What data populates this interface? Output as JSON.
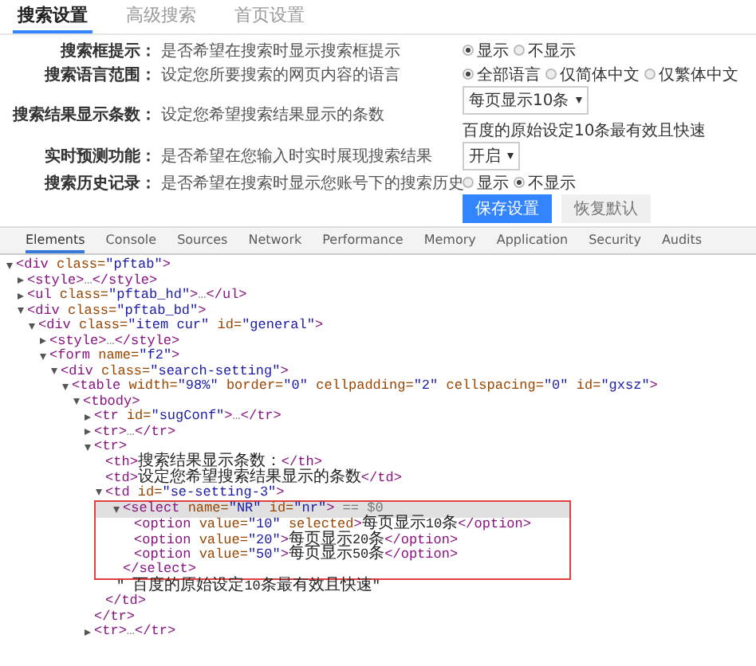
{
  "settings_tabs": [
    {
      "label": "搜索设置",
      "selected": true
    },
    {
      "label": "高级搜索",
      "selected": false
    },
    {
      "label": "首页设置",
      "selected": false
    }
  ],
  "settings_rows": [
    {
      "kind": "radio",
      "label": "搜索框提示：",
      "description": "是否希望在搜索时显示搜索框提示",
      "options": [
        {
          "label": "显示",
          "selected": true
        },
        {
          "label": "不显示",
          "selected": false
        }
      ]
    },
    {
      "kind": "radio",
      "label": "搜索语言范围：",
      "description": "设定您所要搜索的网页内容的语言",
      "options": [
        {
          "label": "全部语言",
          "selected": true
        },
        {
          "label": "仅简体中文",
          "selected": false
        },
        {
          "label": "仅繁体中文",
          "selected": false
        }
      ]
    },
    {
      "kind": "select",
      "label": "搜索结果显示条数：",
      "description": "设定您希望搜索结果显示的条数",
      "value": "每页显示10条",
      "note": "百度的原始设定10条最有效且快速"
    },
    {
      "kind": "select",
      "label": "实时预测功能：",
      "description": "是否希望在您输入时实时展现搜索结果",
      "value": "开启"
    },
    {
      "kind": "radio",
      "label": "搜索历史记录：",
      "description": "是否希望在搜索时显示您账号下的搜索历史",
      "options": [
        {
          "label": "显示",
          "selected": false
        },
        {
          "label": "不显示",
          "selected": true
        }
      ]
    }
  ],
  "buttons": [
    {
      "label": "保存设置",
      "kind": "primary"
    },
    {
      "label": "恢复默认",
      "kind": "secondary"
    }
  ],
  "devtools_tabs": [
    {
      "label": "Elements",
      "selected": true
    },
    {
      "label": "Console",
      "selected": false
    },
    {
      "label": "Sources",
      "selected": false
    },
    {
      "label": "Network",
      "selected": false
    },
    {
      "label": "Performance",
      "selected": false
    },
    {
      "label": "Memory",
      "selected": false
    },
    {
      "label": "Application",
      "selected": false
    },
    {
      "label": "Security",
      "selected": false
    },
    {
      "label": "Audits",
      "selected": false
    }
  ],
  "dom_tree": [
    {
      "text": "<div class=\"pftab\">",
      "expanded": true,
      "selected": false,
      "children": [
        {
          "text": "<style>…</style>",
          "expanded": false,
          "selected": false
        },
        {
          "text": "<ul class=\"pftab_hd\">…</ul>",
          "expanded": false,
          "selected": false
        },
        {
          "text": "<div class=\"pftab_bd\">",
          "expanded": true,
          "selected": false,
          "children": [
            {
              "text": "<div class=\"item cur\" id=\"general\">",
              "expanded": true,
              "selected": false,
              "children": [
                {
                  "text": "<style>…</style>",
                  "expanded": false,
                  "selected": false
                },
                {
                  "text": "<form name=\"f2\">",
                  "expanded": true,
                  "selected": false,
                  "children": [
                    {
                      "text": "<div class=\"search-setting\">",
                      "expanded": true,
                      "selected": false,
                      "children": [
                        {
                          "text": "<table width=\"98%\" border=\"0\" cellpadding=\"2\" cellspacing=\"0\" id=\"gxsz\">",
                          "expanded": true,
                          "selected": false,
                          "children": [
                            {
                              "text": "<tbody>",
                              "expanded": true,
                              "selected": false,
                              "children": [
                                {
                                  "text": "<tr id=\"sugConf\">…</tr>",
                                  "expanded": false,
                                  "selected": false
                                },
                                {
                                  "text": "<tr>…</tr>",
                                  "expanded": false,
                                  "selected": false
                                },
                                {
                                  "text": "<tr>",
                                  "expanded": true,
                                  "selected": false,
                                  "close": "</tr>",
                                  "children": [
                                    {
                                      "text": "<th>搜索结果显示条数：</th>",
                                      "selected": false
                                    },
                                    {
                                      "text": "<td>设定您希望搜索结果显示的条数</td>",
                                      "selected": false
                                    },
                                    {
                                      "text": "<td id=\"se-setting-3\">",
                                      "expanded": true,
                                      "selected": false,
                                      "close": "</td>",
                                      "children": [
                                        {
                                          "text": "<select name=\"NR\" id=\"nr\">",
                                          "suffix": " == $0",
                                          "expanded": true,
                                          "selected": true,
                                          "close": "</select>",
                                          "children": [
                                            {
                                              "text": "<option value=\"10\" selected>每页显示10条</option>",
                                              "selected": false
                                            },
                                            {
                                              "text": "<option value=\"20\">每页显示20条</option>",
                                              "selected": false
                                            },
                                            {
                                              "text": "<option value=\"50\">每页显示50条</option>",
                                              "selected": false
                                            }
                                          ]
                                        },
                                        {
                                          "text": "\" 百度的原始设定10条最有效且快速\"",
                                          "selected": false
                                        }
                                      ]
                                    }
                                  ]
                                },
                                {
                                  "text": "<tr>…</tr>",
                                  "expanded": false,
                                  "selected": false
                                }
                              ]
                            }
                          ]
                        }
                      ]
                    }
                  ]
                }
              ]
            }
          ]
        }
      ]
    }
  ]
}
